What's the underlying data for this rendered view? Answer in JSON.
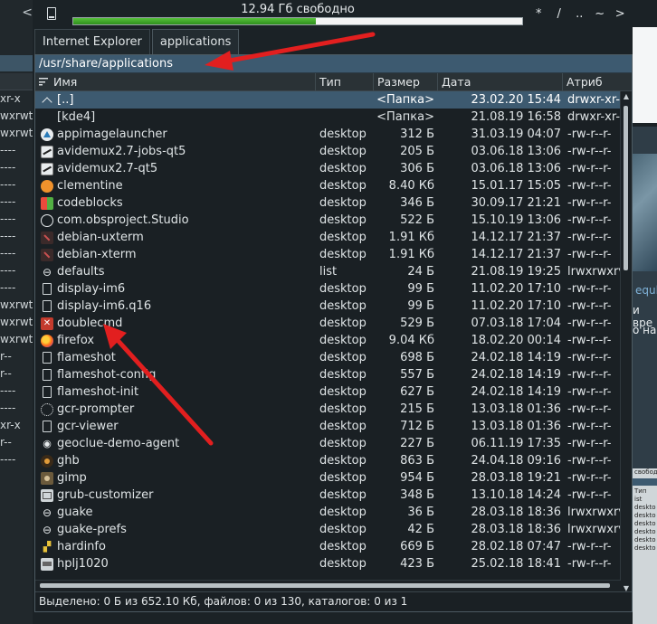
{
  "topbar": {
    "free_space": "12.94 Гб свободно",
    "used_fraction": 0.54,
    "nav_buttons": [
      "*",
      "/",
      "..",
      "~",
      ">"
    ]
  },
  "tabs": [
    {
      "label": "Internet Explorer",
      "active": false
    },
    {
      "label": "applications",
      "active": true
    }
  ],
  "path": "/usr/share/applications",
  "columns": {
    "name": "Имя",
    "type": "Тип",
    "size": "Размер",
    "date": "Дата",
    "attr": "Атриб"
  },
  "files": [
    {
      "name": "[..]",
      "type": "",
      "size": "<Папка>",
      "date": "23.02.20 15:44",
      "attr": "drwxr-xr-",
      "icon": "up-folder-icon",
      "selected": true
    },
    {
      "name": "[kde4]",
      "type": "",
      "size": "<Папка>",
      "date": "21.08.19 16:58",
      "attr": "drwxr-xr-",
      "icon": "blank-icon"
    },
    {
      "name": "appimagelauncher",
      "type": "desktop",
      "size": "312 Б",
      "date": "31.03.19 04:07",
      "attr": "-rw-r--r-",
      "icon": "appimage-icon"
    },
    {
      "name": "avidemux2.7-jobs-qt5",
      "type": "desktop",
      "size": "205 Б",
      "date": "03.06.18 13:06",
      "attr": "-rw-r--r-",
      "icon": "avidemux-icon"
    },
    {
      "name": "avidemux2.7-qt5",
      "type": "desktop",
      "size": "306 Б",
      "date": "03.06.18 13:06",
      "attr": "-rw-r--r-",
      "icon": "avidemux-icon"
    },
    {
      "name": "clementine",
      "type": "desktop",
      "size": "8.40 Кб",
      "date": "15.01.17 15:05",
      "attr": "-rw-r--r-",
      "icon": "clementine-icon"
    },
    {
      "name": "codeblocks",
      "type": "desktop",
      "size": "346 Б",
      "date": "30.09.17 21:21",
      "attr": "-rw-r--r-",
      "icon": "codeblocks-icon"
    },
    {
      "name": "com.obsproject.Studio",
      "type": "desktop",
      "size": "522 Б",
      "date": "15.10.19 13:06",
      "attr": "-rw-r--r-",
      "icon": "obs-icon"
    },
    {
      "name": "debian-uxterm",
      "type": "desktop",
      "size": "1.91 Кб",
      "date": "14.12.17 21:37",
      "attr": "-rw-r--r-",
      "icon": "terminal-icon"
    },
    {
      "name": "debian-xterm",
      "type": "desktop",
      "size": "1.91 Кб",
      "date": "14.12.17 21:37",
      "attr": "-rw-r--r-",
      "icon": "terminal-icon"
    },
    {
      "name": "defaults",
      "type": "list",
      "size": "24 Б",
      "date": "21.08.19 19:25",
      "attr": "lrwxrwxrv",
      "icon": "symlink-icon"
    },
    {
      "name": "display-im6",
      "type": "desktop",
      "size": "99 Б",
      "date": "11.02.20 17:10",
      "attr": "-rw-r--r-",
      "icon": "file-icon"
    },
    {
      "name": "display-im6.q16",
      "type": "desktop",
      "size": "99 Б",
      "date": "11.02.20 17:10",
      "attr": "-rw-r--r-",
      "icon": "file-icon"
    },
    {
      "name": "doublecmd",
      "type": "desktop",
      "size": "529 Б",
      "date": "07.03.18 17:04",
      "attr": "-rw-r--r-",
      "icon": "doublecmd-icon"
    },
    {
      "name": "firefox",
      "type": "desktop",
      "size": "9.04 Кб",
      "date": "18.02.20 00:14",
      "attr": "-rw-r--r-",
      "icon": "firefox-icon"
    },
    {
      "name": "flameshot",
      "type": "desktop",
      "size": "698 Б",
      "date": "24.02.18 14:19",
      "attr": "-rw-r--r-",
      "icon": "file-icon"
    },
    {
      "name": "flameshot-config",
      "type": "desktop",
      "size": "557 Б",
      "date": "24.02.18 14:19",
      "attr": "-rw-r--r-",
      "icon": "file-icon"
    },
    {
      "name": "flameshot-init",
      "type": "desktop",
      "size": "627 Б",
      "date": "24.02.18 14:19",
      "attr": "-rw-r--r-",
      "icon": "file-icon"
    },
    {
      "name": "gcr-prompter",
      "type": "desktop",
      "size": "215 Б",
      "date": "13.03.18 01:36",
      "attr": "-rw-r--r-",
      "icon": "gear-icon"
    },
    {
      "name": "gcr-viewer",
      "type": "desktop",
      "size": "712 Б",
      "date": "13.03.18 01:36",
      "attr": "-rw-r--r-",
      "icon": "file-icon"
    },
    {
      "name": "geoclue-demo-agent",
      "type": "desktop",
      "size": "227 Б",
      "date": "06.11.19 17:35",
      "attr": "-rw-r--r-",
      "icon": "location-pin-icon"
    },
    {
      "name": "ghb",
      "type": "desktop",
      "size": "863 Б",
      "date": "24.04.18 09:16",
      "attr": "-rw-r--r-",
      "icon": "handbrake-icon"
    },
    {
      "name": "gimp",
      "type": "desktop",
      "size": "954 Б",
      "date": "28.03.18 19:21",
      "attr": "-rw-r--r-",
      "icon": "gimp-icon"
    },
    {
      "name": "grub-customizer",
      "type": "desktop",
      "size": "348 Б",
      "date": "13.10.18 14:24",
      "attr": "-rw-r--r-",
      "icon": "grub-icon"
    },
    {
      "name": "guake",
      "type": "desktop",
      "size": "36 Б",
      "date": "28.03.18 18:36",
      "attr": "lrwxrwxrv",
      "icon": "symlink-icon"
    },
    {
      "name": "guake-prefs",
      "type": "desktop",
      "size": "42 Б",
      "date": "28.03.18 18:36",
      "attr": "lrwxrwxrv",
      "icon": "symlink-icon"
    },
    {
      "name": "hardinfo",
      "type": "desktop",
      "size": "669 Б",
      "date": "28.02.18 07:47",
      "attr": "-rw-r--r-",
      "icon": "hardinfo-icon"
    },
    {
      "name": "hplj1020",
      "type": "desktop",
      "size": "423 Б",
      "date": "25.02.18 18:41",
      "attr": "-rw-r--r-",
      "icon": "printer-icon"
    }
  ],
  "status": "Выделено: 0 Б из 652.10 Кб, файлов: 0 из 130, каталогов: 0 из 1",
  "left_panel": {
    "top_glyph": "<",
    "rows": [
      "xr-x",
      "wxrwt",
      "wxrwt",
      "----",
      "----",
      "----",
      "----",
      "----",
      "----",
      "----",
      "----",
      "----",
      "wxrwt",
      "wxrwt",
      "wxrwt",
      "r--",
      "r--",
      "----",
      "----",
      "xr-x",
      "r--",
      "----"
    ]
  },
  "right_fragment": {
    "text1": "equl",
    "text2": "и вре",
    "text3": "о на",
    "mini_lines": [
      "свобод",
      "Тип",
      "ist",
      "deskto",
      "deskto",
      "deskto",
      "deskto",
      "deskto",
      "deskto"
    ]
  },
  "colors": {
    "selection": "#3d5a70",
    "background": "#1a2024",
    "annotation_arrow": "#e21f1f"
  }
}
